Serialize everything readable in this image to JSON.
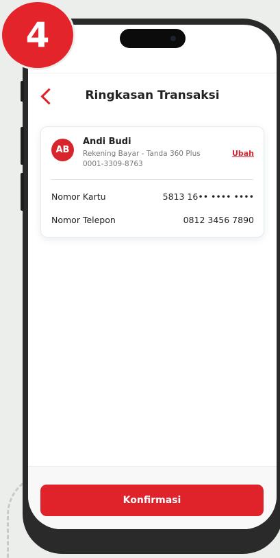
{
  "step": {
    "number": "4"
  },
  "header": {
    "title": "Ringkasan Transaksi"
  },
  "account": {
    "initials": "AB",
    "name": "Andi Budi",
    "account_type": "Rekening Bayar - Tanda 360 Plus",
    "account_number": "0001-3309-8763",
    "change_label": "Ubah"
  },
  "details": [
    {
      "label": "Nomor Kartu",
      "value": "5813 16•• •••• ••••"
    },
    {
      "label": "Nomor Telepon",
      "value": "0812 3456 7890"
    }
  ],
  "footer": {
    "confirm_label": "Konfirmasi"
  },
  "colors": {
    "accent": "#e0232b",
    "background": "#eceeec"
  }
}
